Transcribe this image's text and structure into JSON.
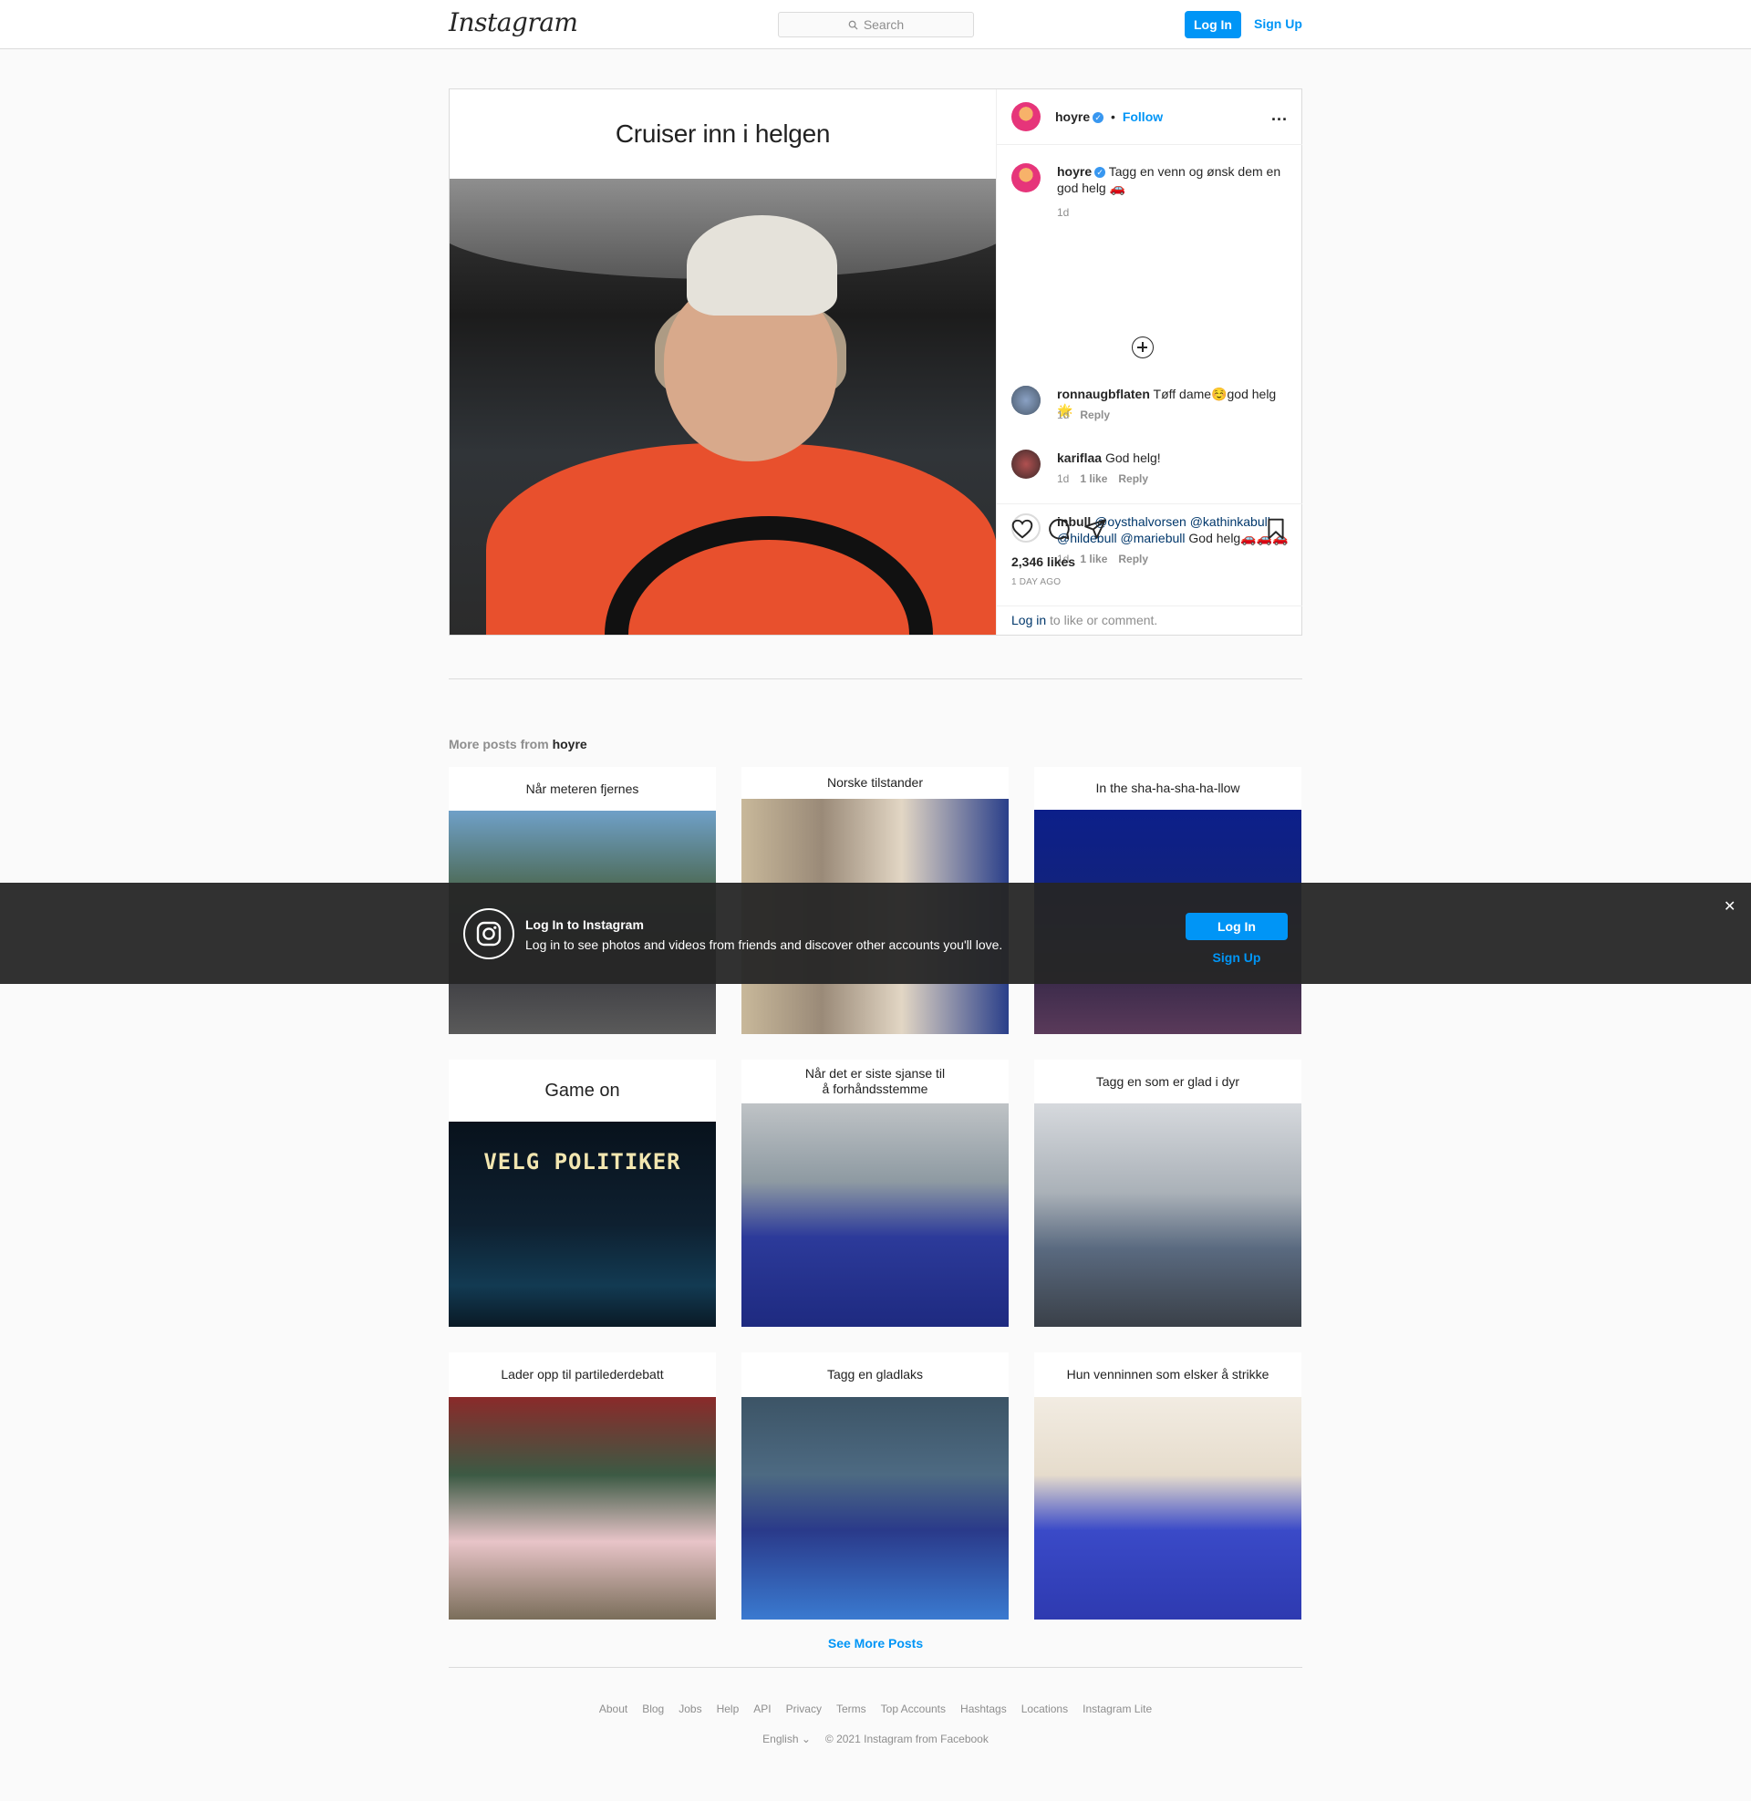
{
  "nav": {
    "logo": "Instagram",
    "search_placeholder": "Search",
    "login": "Log In",
    "signup": "Sign Up"
  },
  "post": {
    "image_caption": "Cruiser inn i helgen",
    "username": "hoyre",
    "follow": "Follow",
    "more": "...",
    "caption": {
      "username": "hoyre",
      "text": "Tagg en venn og ønsk dem en god helg 🚗",
      "time": "1d"
    },
    "comments": [
      {
        "username": "ronnaugbflaten",
        "text": "Tøff dame☺️god helg🌟",
        "time": "1d",
        "likes": "",
        "reply": "Reply"
      },
      {
        "username": "kariflaa",
        "text": "God helg!",
        "time": "1d",
        "likes": "1 like",
        "reply": "Reply"
      },
      {
        "username": "inbull",
        "mentions": [
          "@oysthalvorsen",
          "@kathinkabull",
          "@hildebull",
          "@mariebull"
        ],
        "text": "God helg🚗🚗🚗",
        "time": "1d",
        "likes": "1 like",
        "reply": "Reply"
      }
    ],
    "likes": "2,346 likes",
    "time_ago": "1 DAY AGO",
    "login_link": "Log in",
    "login_suffix": " to like or comment."
  },
  "more_posts": {
    "label": "More posts from ",
    "username": "hoyre",
    "tiles": [
      "Når meteren fjernes",
      "Norske tilstander",
      "In the sha-ha-sha-ha-llow",
      "Game on",
      "Når det er siste sjanse til\nå forhåndsstemme",
      "Tagg en som er glad i dyr",
      "Lader opp til partilederdebatt",
      "Tagg en gladlaks",
      "Hun venninnen som elsker å strikke"
    ],
    "game_text": "VELG POLITIKER",
    "see_more": "See More Posts"
  },
  "footer": {
    "links": [
      "About",
      "Blog",
      "Jobs",
      "Help",
      "API",
      "Privacy",
      "Terms",
      "Top Accounts",
      "Hashtags",
      "Locations",
      "Instagram Lite"
    ],
    "language": "English",
    "copyright": "© 2021 Instagram from Facebook"
  },
  "banner": {
    "title": "Log In to Instagram",
    "text": "Log in to see photos and videos from friends and discover other accounts you'll love.",
    "login": "Log In",
    "signup": "Sign Up",
    "close": "✕"
  },
  "colors": {
    "accent": "#0095f6",
    "verified": "#3897f0",
    "banner_bg": "#262626"
  }
}
